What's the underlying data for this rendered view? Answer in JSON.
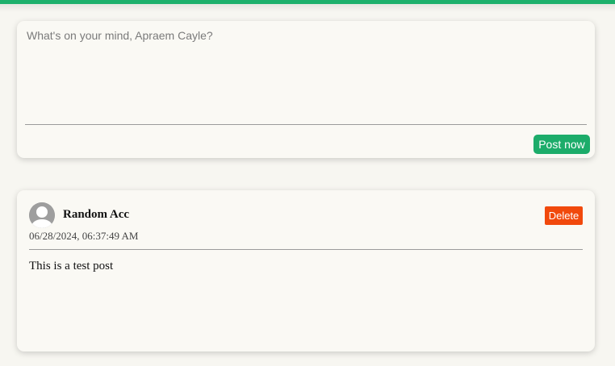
{
  "composer": {
    "placeholder": "What's on your mind, Apraem Cayle?",
    "post_label": "Post now",
    "accent": "#1cac6a"
  },
  "post": {
    "author": "Random Acc",
    "timestamp": "06/28/2024, 06:37:49 AM",
    "body": "This is a test post",
    "delete_label": "Delete",
    "delete_color": "#f1490c"
  },
  "icons": {
    "avatar": "default-user-avatar"
  }
}
